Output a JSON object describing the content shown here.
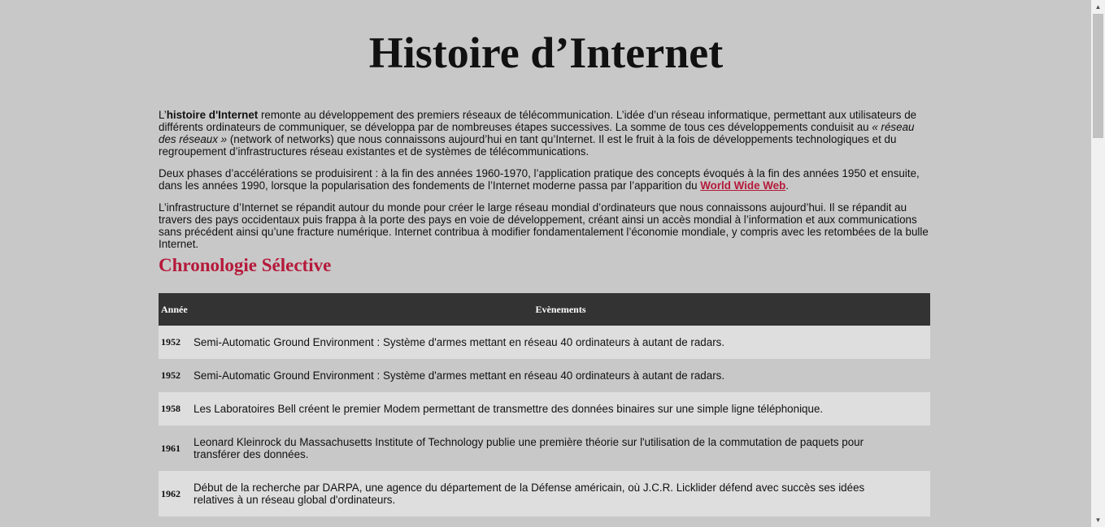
{
  "title": "Histoire d’Internet",
  "intro": {
    "p1": {
      "pre": "L’",
      "bold": "histoire d'Internet",
      "mid": " remonte au développement des premiers réseaux de télécommunication. L’idée d’un réseau informatique, permettant aux utilisateurs de différents ordinateurs de communiquer, se développa par de nombreuses étapes successives. La somme de tous ces développements conduisit au ",
      "italic": "« réseau des réseaux »",
      "post": " (network of networks) que nous connaissons aujourd’hui en tant qu’Internet. Il est le fruit à la fois de développements technologiques et du regroupement d’infrastructures réseau existantes et de systèmes de télécommunications."
    },
    "p2": {
      "text": "Deux phases d’accélérations se produisirent : à la fin des années 1960-1970, l’application pratique des concepts évoqués à la fin des années 1950 et ensuite, dans les années 1990, lorsque la popularisation des fondements de l’Internet moderne passa par l’apparition du ",
      "link": "World Wide Web",
      "end": "."
    },
    "p3": "L’infrastructure d’Internet se répandit autour du monde pour créer le large réseau mondial d’ordinateurs que nous connaissons aujourd’hui. Il se répandit au travers des pays occidentaux puis frappa à la porte des pays en voie de développement, créant ainsi un accès mondial à l’information et aux communications sans précédent ainsi qu’une fracture numérique. Internet contribua à modifier fondamentalement l’économie mondiale, y compris avec les retombées de la bulle Internet."
  },
  "chronology": {
    "heading": "Chronologie Sélective",
    "headers": {
      "year": "Année",
      "event": "Evènements"
    },
    "rows": [
      {
        "year": "1952",
        "event": "Semi-Automatic Ground Environment : Système d'armes mettant en réseau 40 ordinateurs à autant de radars."
      },
      {
        "year": "1952",
        "event": "Semi-Automatic Ground Environment : Système d'armes mettant en réseau 40 ordinateurs à autant de radars."
      },
      {
        "year": "1958",
        "event": "Les Laboratoires Bell créent le premier Modem permettant de transmettre des données binaires sur une simple ligne téléphonique."
      },
      {
        "year": "1961",
        "event": "Leonard Kleinrock du Massachusetts Institute of Technology publie une première théorie sur l'utilisation de la commutation de paquets pour transférer des données."
      },
      {
        "year": "1962",
        "event": "Début de la recherche par DARPA, une agence du département de la Défense américain, où J.C.R. Licklider défend avec succès ses idées relatives à un réseau global d'ordinateurs."
      }
    ]
  },
  "scrollbar": {
    "up_glyph": "▲",
    "down_glyph": "▼"
  }
}
